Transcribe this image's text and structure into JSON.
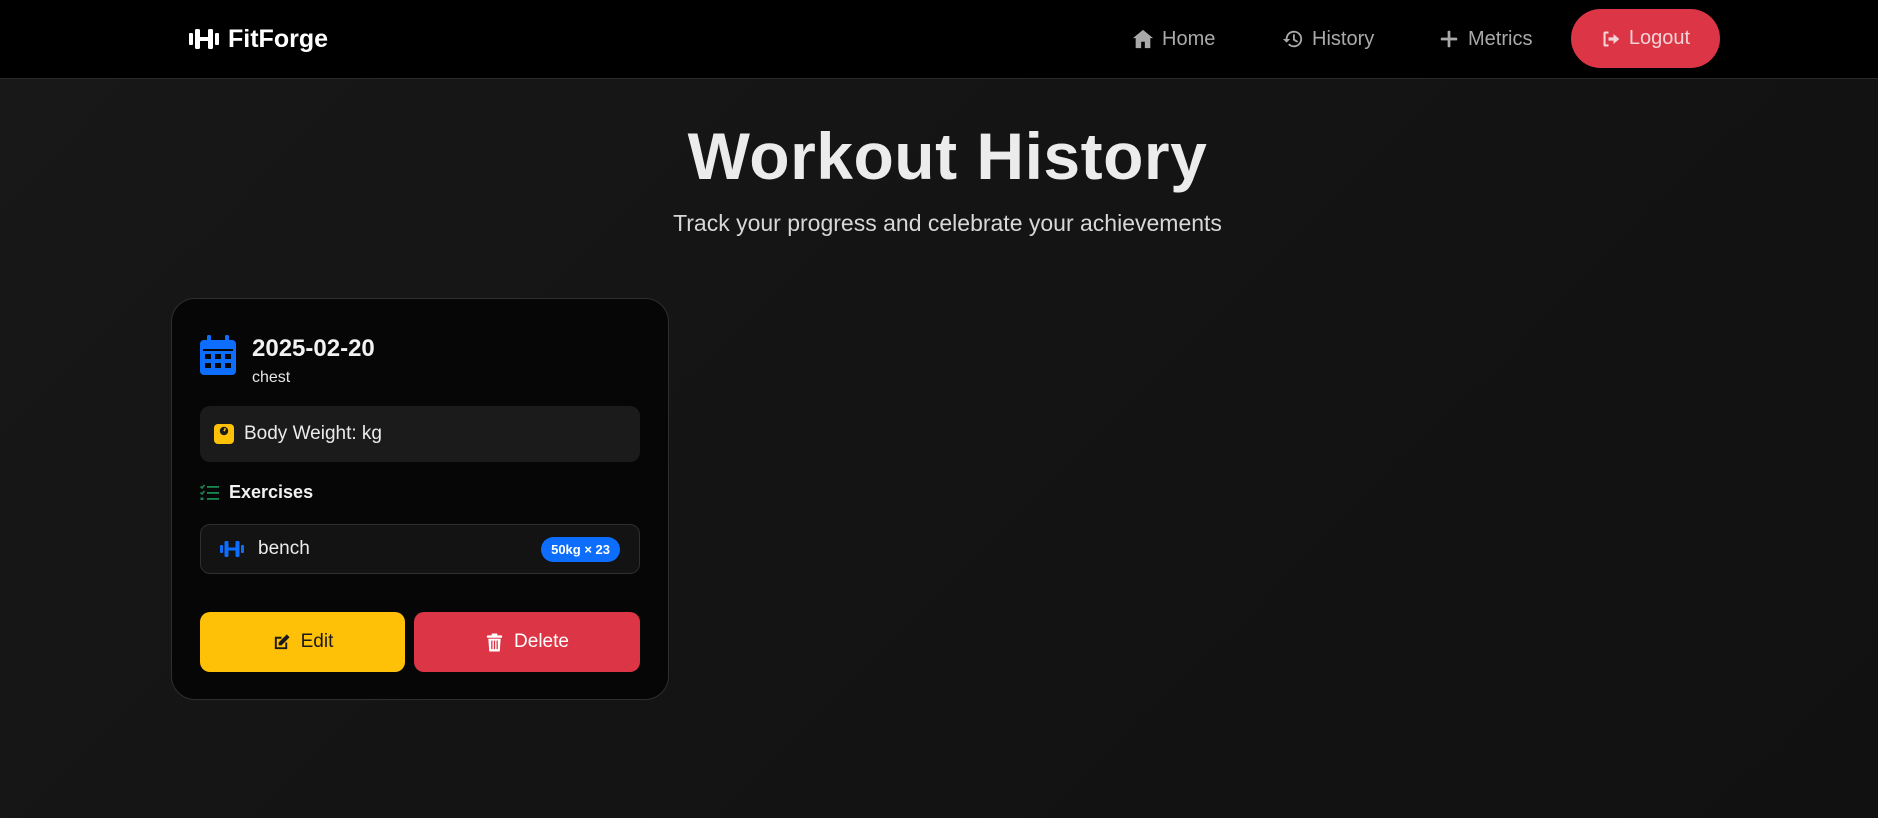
{
  "app": {
    "brand_name": "FitForge",
    "brand_icon": "dumbbell-icon"
  },
  "nav": {
    "home_label": "Home",
    "history_label": "History",
    "metrics_label": "Metrics",
    "logout_label": "Logout"
  },
  "page": {
    "title": "Workout History",
    "subtitle": "Track your progress and celebrate your achievements"
  },
  "workouts": [
    {
      "date": "2025-02-20",
      "type": "chest",
      "body_weight_label": "Body Weight: kg",
      "exercises_heading": "Exercises",
      "exercises": [
        {
          "name": "bench",
          "badge": "50kg × 23"
        }
      ],
      "edit_label": "Edit",
      "delete_label": "Delete"
    }
  ],
  "colors": {
    "accent_blue": "#0d6efd",
    "warning_yellow": "#ffc107",
    "danger_red": "#dc3545",
    "success_green": "#198754"
  }
}
